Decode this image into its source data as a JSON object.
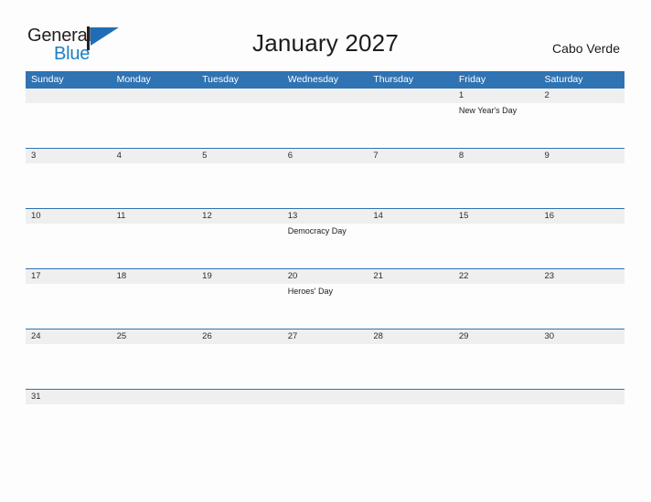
{
  "brand": {
    "name_part1": "General",
    "name_part2": "Blue",
    "flag_icon": "flag-icon",
    "accent_color": "#1b7fc4"
  },
  "header": {
    "title": "January 2027",
    "country": "Cabo Verde"
  },
  "theme": {
    "header_blue": "#2f73b3",
    "num_band_gray": "#efefef",
    "page_bg": "#fdfdfd",
    "text": "#1c1c1c"
  },
  "calendar": {
    "month": "January",
    "year": "2027",
    "weekday_headers": [
      "Sunday",
      "Monday",
      "Tuesday",
      "Wednesday",
      "Thursday",
      "Friday",
      "Saturday"
    ],
    "weeks": [
      [
        {
          "day": "",
          "event": ""
        },
        {
          "day": "",
          "event": ""
        },
        {
          "day": "",
          "event": ""
        },
        {
          "day": "",
          "event": ""
        },
        {
          "day": "",
          "event": ""
        },
        {
          "day": "1",
          "event": "New Year's Day"
        },
        {
          "day": "2",
          "event": ""
        }
      ],
      [
        {
          "day": "3",
          "event": ""
        },
        {
          "day": "4",
          "event": ""
        },
        {
          "day": "5",
          "event": ""
        },
        {
          "day": "6",
          "event": ""
        },
        {
          "day": "7",
          "event": ""
        },
        {
          "day": "8",
          "event": ""
        },
        {
          "day": "9",
          "event": ""
        }
      ],
      [
        {
          "day": "10",
          "event": ""
        },
        {
          "day": "11",
          "event": ""
        },
        {
          "day": "12",
          "event": ""
        },
        {
          "day": "13",
          "event": "Democracy Day"
        },
        {
          "day": "14",
          "event": ""
        },
        {
          "day": "15",
          "event": ""
        },
        {
          "day": "16",
          "event": ""
        }
      ],
      [
        {
          "day": "17",
          "event": ""
        },
        {
          "day": "18",
          "event": ""
        },
        {
          "day": "19",
          "event": ""
        },
        {
          "day": "20",
          "event": "Heroes' Day"
        },
        {
          "day": "21",
          "event": ""
        },
        {
          "day": "22",
          "event": ""
        },
        {
          "day": "23",
          "event": ""
        }
      ],
      [
        {
          "day": "24",
          "event": ""
        },
        {
          "day": "25",
          "event": ""
        },
        {
          "day": "26",
          "event": ""
        },
        {
          "day": "27",
          "event": ""
        },
        {
          "day": "28",
          "event": ""
        },
        {
          "day": "29",
          "event": ""
        },
        {
          "day": "30",
          "event": ""
        }
      ],
      [
        {
          "day": "31",
          "event": ""
        },
        {
          "day": "",
          "event": ""
        },
        {
          "day": "",
          "event": ""
        },
        {
          "day": "",
          "event": ""
        },
        {
          "day": "",
          "event": ""
        },
        {
          "day": "",
          "event": ""
        },
        {
          "day": "",
          "event": ""
        }
      ]
    ]
  }
}
